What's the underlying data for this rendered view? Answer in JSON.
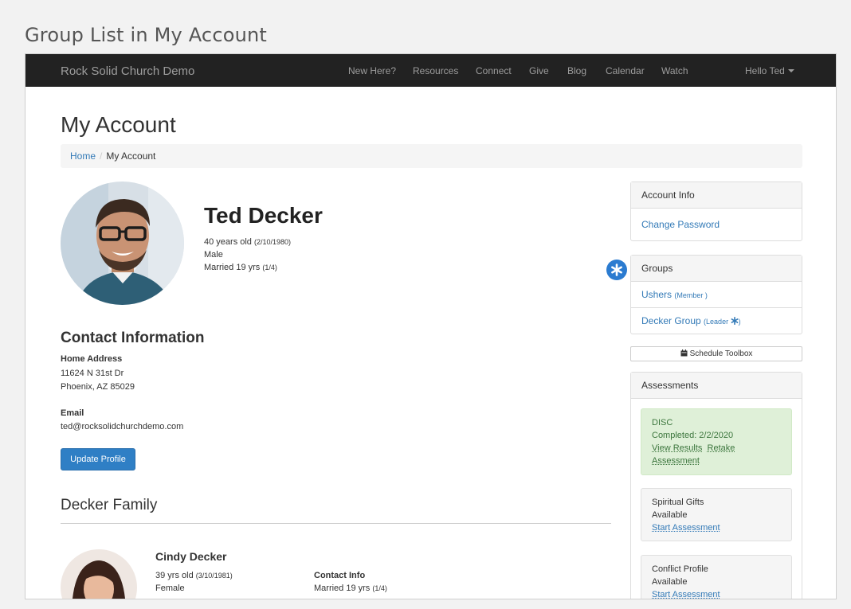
{
  "caption": "Group List in My Account",
  "navbar": {
    "brand": "Rock Solid Church Demo",
    "links": [
      "New Here?",
      "Resources",
      "Connect",
      "Give",
      "Blog",
      "Calendar",
      "Watch"
    ],
    "user_menu": "Hello Ted"
  },
  "page": {
    "title": "My Account",
    "breadcrumb": {
      "home": "Home",
      "current": "My Account"
    }
  },
  "person": {
    "name": "Ted Decker",
    "age": "40 years old",
    "birthdate": "(2/10/1980)",
    "gender": "Male",
    "marital": "Married 19 yrs",
    "marital_detail": "(1/4)"
  },
  "contact": {
    "heading": "Contact Information",
    "address_label": "Home Address",
    "address_line1": "11624 N 31st Dr",
    "address_line2": "Phoenix, AZ 85029",
    "email_label": "Email",
    "email": "ted@rocksolidchurchdemo.com",
    "update_button": "Update Profile"
  },
  "family": {
    "heading": "Decker Family",
    "members": [
      {
        "name": "Cindy Decker",
        "age": "39 yrs old",
        "birthdate": "(3/10/1981)",
        "gender": "Female",
        "contact_label": "Contact Info",
        "marital": "Married 19 yrs",
        "marital_detail": "(1/4)"
      }
    ]
  },
  "account_info": {
    "heading": "Account Info",
    "change_password": "Change Password"
  },
  "groups": {
    "heading": "Groups",
    "items": [
      {
        "name": "Ushers",
        "role_open": "(Member",
        "role_close": ")"
      },
      {
        "name": "Decker Group",
        "role_open": "(Leader",
        "role_close": ")"
      }
    ]
  },
  "schedule_toolbox": "Schedule Toolbox",
  "assessments": {
    "heading": "Assessments",
    "items": [
      {
        "title": "DISC",
        "status": "Completed: 2/2/2020",
        "link1": "View Results",
        "link2": "Retake",
        "link3": "Assessment"
      },
      {
        "title": "Spiritual Gifts",
        "status": "Available",
        "link1": "Start Assessment"
      },
      {
        "title": "Conflict Profile",
        "status": "Available",
        "link1": "Start Assessment"
      }
    ]
  },
  "colors": {
    "navbar_bg": "#222222",
    "link": "#337ab7",
    "primary_button": "#2f7fc5",
    "success_bg": "#dff0d8",
    "badge": "#2b7bd0"
  }
}
